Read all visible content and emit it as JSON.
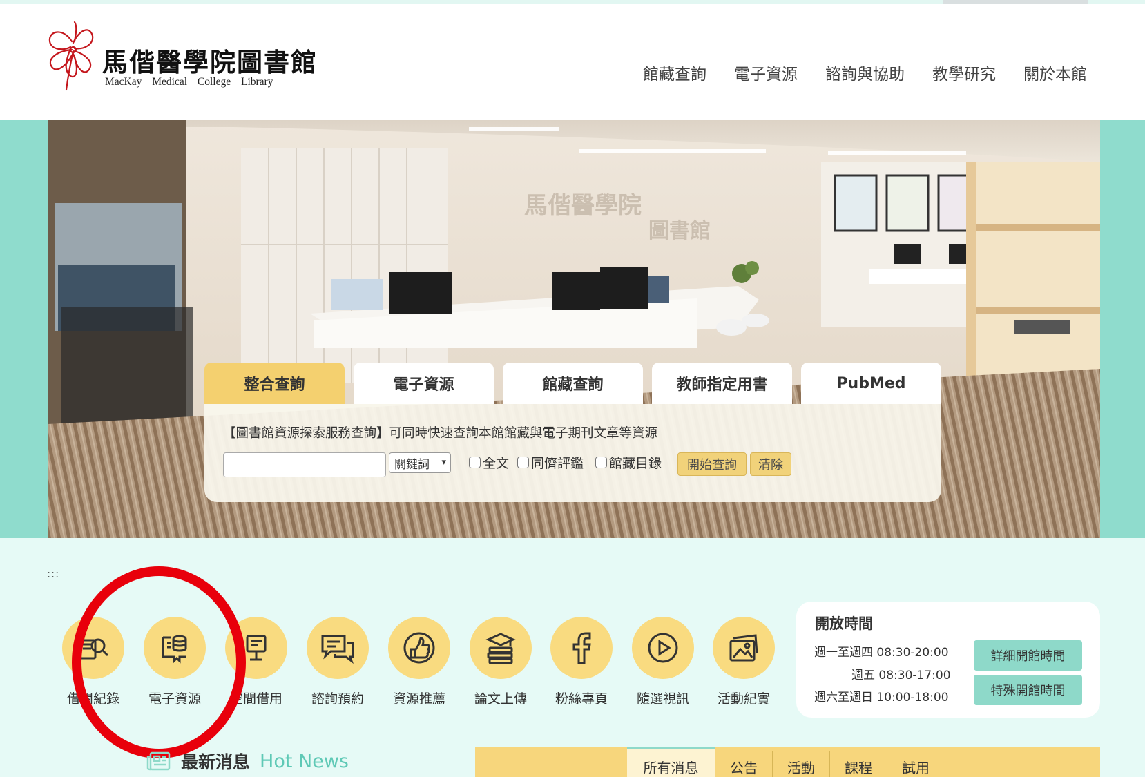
{
  "library": {
    "title_zh": "馬偕醫學院圖書館",
    "title_en": "MacKay Medical College Library"
  },
  "nav": [
    "館藏查詢",
    "電子資源",
    "諮詢與協助",
    "教學研究",
    "關於本館"
  ],
  "hero": {
    "sign_line1": "馬偕醫學院",
    "sign_line2": "圖書館"
  },
  "search": {
    "tabs": [
      "整合查詢",
      "電子資源",
      "館藏查詢",
      "教師指定用書",
      "PubMed"
    ],
    "active_tab": "整合查詢",
    "description": "【圖書館資源探索服務查詢】可同時快速查詢本館館藏與電子期刊文章等資源",
    "input_value": "",
    "select_value": "關鍵詞",
    "options": [
      "全文",
      "同儕評鑑",
      "館藏目錄"
    ],
    "search_button": "開始查詢",
    "clear_button": "清除"
  },
  "skip_link": ":::",
  "quick_links": [
    {
      "label": "借閱紀錄",
      "icon": "book-search-icon"
    },
    {
      "label": "電子資源",
      "icon": "ebook-database-icon"
    },
    {
      "label": "空間借用",
      "icon": "space-booking-icon"
    },
    {
      "label": "諮詢預約",
      "icon": "chat-bubbles-icon"
    },
    {
      "label": "資源推薦",
      "icon": "thumbs-up-icon"
    },
    {
      "label": "論文上傳",
      "icon": "graduation-books-icon"
    },
    {
      "label": "粉絲專頁",
      "icon": "facebook-icon"
    },
    {
      "label": "隨選視訊",
      "icon": "play-icon"
    },
    {
      "label": "活動紀實",
      "icon": "photos-icon"
    }
  ],
  "hours": {
    "title": "開放時間",
    "rows": [
      {
        "days": "週一至週四",
        "time": "08:30-20:00"
      },
      {
        "days": "週五",
        "time": "08:30-17:00"
      },
      {
        "days": "週六至週日",
        "time": "10:00-18:00"
      }
    ],
    "detail_button": "詳細開館時間",
    "special_button": "特殊開館時間"
  },
  "news": {
    "title_zh": "最新消息",
    "title_en": "Hot News",
    "tabs": [
      "所有消息",
      "公告",
      "活動",
      "課程",
      "試用"
    ],
    "active_tab": "所有消息"
  },
  "colors": {
    "teal_band": "#8fdccd",
    "page_bg": "#e6faf6",
    "accent_yellow": "#f4d06f",
    "annotation_red": "#e8000b"
  }
}
